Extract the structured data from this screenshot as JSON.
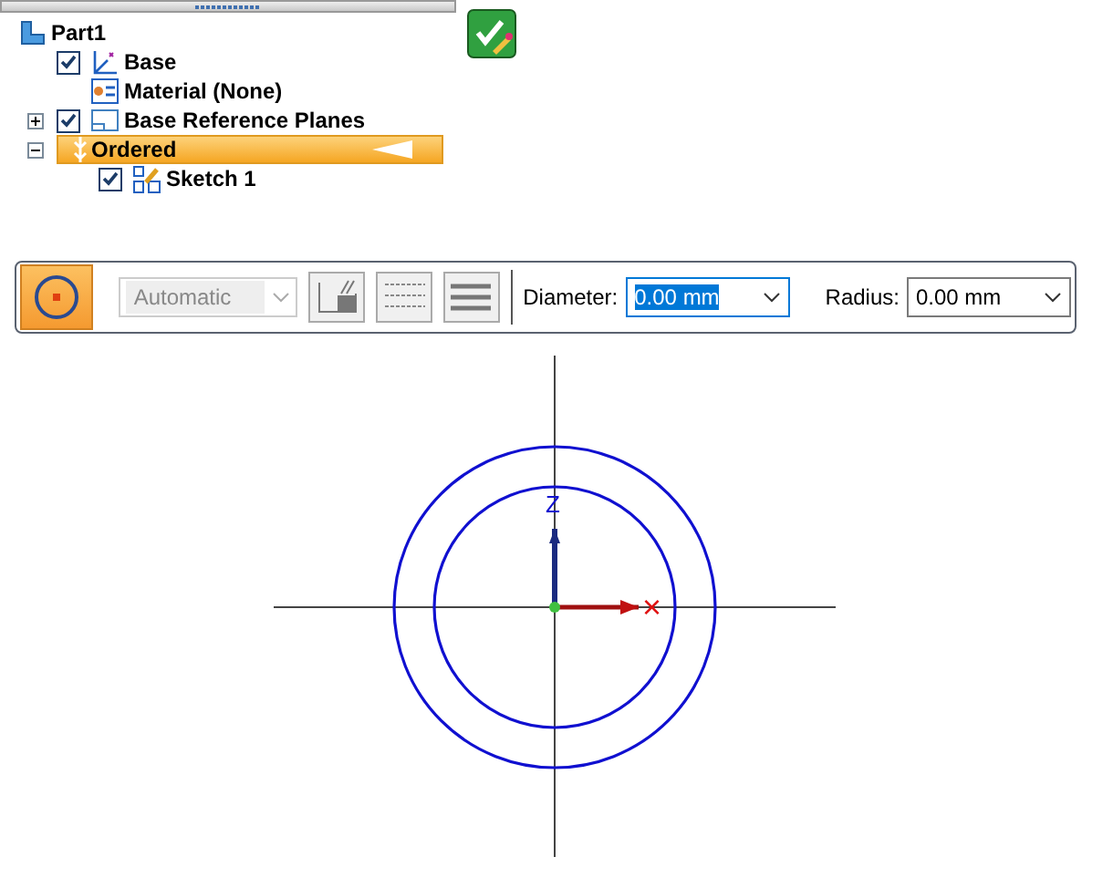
{
  "tree": [
    {
      "label": "Part1",
      "kind": "part",
      "children": [
        {
          "label": "Base",
          "kind": "coordinate",
          "checked": true
        },
        {
          "label": "Material (None)",
          "kind": "material"
        },
        {
          "label": "Base Reference Planes",
          "kind": "planes",
          "checked": true,
          "expanded": false
        },
        {
          "label": "Ordered",
          "kind": "ordered",
          "expanded": true,
          "selected": true,
          "children": [
            {
              "label": "Sketch 1",
              "kind": "sketch",
              "checked": true
            }
          ]
        }
      ]
    }
  ],
  "toolbar": {
    "circle_tool": {
      "selected": true
    },
    "mode": {
      "value": "Automatic",
      "disabled": true
    },
    "diameter": {
      "label": "Diameter:",
      "value": "0.00 mm",
      "focused": true
    },
    "radius": {
      "label": "Radius:",
      "value": "0.00 mm",
      "focused": false
    }
  },
  "canvas": {
    "axis_z": "Z",
    "axis_x": "×"
  }
}
